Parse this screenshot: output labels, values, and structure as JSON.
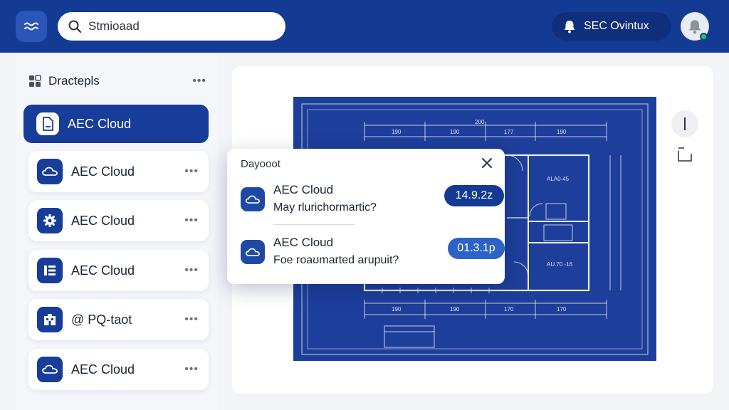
{
  "search": {
    "text": "Stmioaad"
  },
  "account": {
    "name": "SEC Ovintux"
  },
  "sidebar": {
    "title": "Dractepls",
    "more": "•••",
    "items": [
      {
        "label": "AEC Cloud",
        "icon": "document-icon",
        "active": true
      },
      {
        "label": "AEC Cloud",
        "icon": "cloud-icon",
        "more": "•••"
      },
      {
        "label": "AEC Cloud",
        "icon": "gear-icon",
        "more": "•••"
      },
      {
        "label": "AEC Cloud",
        "icon": "list-icon",
        "more": "•••"
      },
      {
        "label": "@ PQ-taot",
        "icon": "grid-icon",
        "more": "•••"
      },
      {
        "label": "AEC Cloud",
        "icon": "cloud-icon",
        "more": "•••"
      }
    ]
  },
  "popup": {
    "title": "Dayooot",
    "rows": [
      {
        "name": "AEC Cloud",
        "desc": "May rlurichormartic?",
        "badge": "14.9.2z",
        "icon": "cloud-icon"
      },
      {
        "name": "AEC Cloud",
        "desc": "Foe roaʊmarted arupuit?",
        "badge": "01.3.1p",
        "icon": "cloud-icon"
      }
    ]
  },
  "blueprint": {
    "top_dims": [
      "200",
      "190",
      "190",
      "177",
      "190"
    ],
    "bottom_dims": [
      "190",
      "190",
      "170",
      "170"
    ],
    "room_labels": [
      "ALA0-45",
      "AU.70 -16"
    ]
  },
  "colors": {
    "brand": "#143b94",
    "accent": "#2f62c8",
    "blueprint": "#1d3e9a",
    "online": "#2ec45a"
  }
}
